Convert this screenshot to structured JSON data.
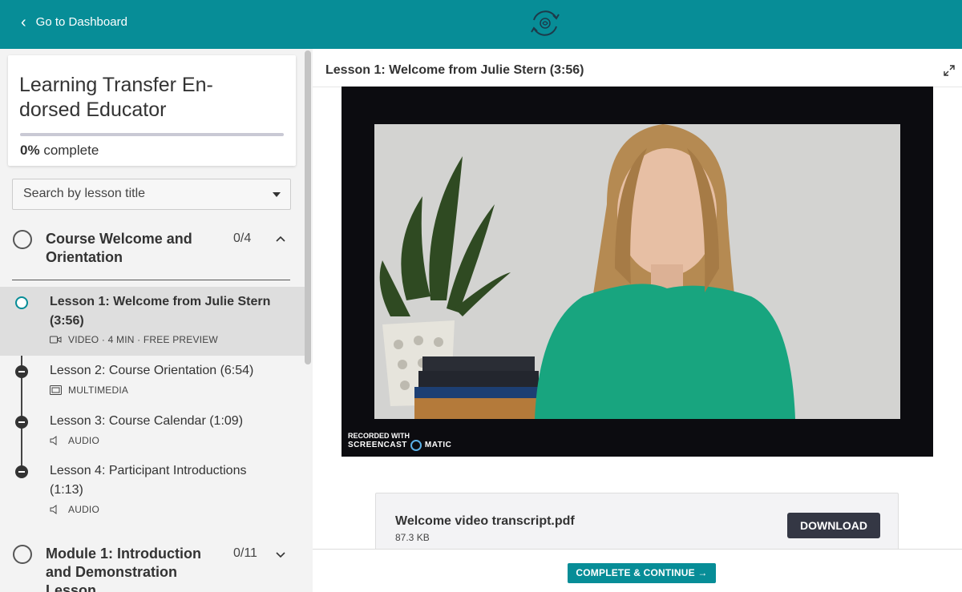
{
  "topbar": {
    "back_label": "Go to Dashboard",
    "accent_color": "#078d97"
  },
  "course": {
    "title": "Learning Transfer En-dorsed Educator",
    "progress_percent": "0%",
    "progress_suffix": "complete",
    "progress_value": 0
  },
  "search": {
    "placeholder": "Search by lesson title"
  },
  "modules": [
    {
      "title": "Course Welcome and Orientation",
      "count": "0/4",
      "expanded": true,
      "lessons": [
        {
          "title": "Lesson 1: Welcome from Julie Stern (3:56)",
          "meta": "VIDEO · 4 MIN · FREE PREVIEW",
          "icon": "video-camera-icon",
          "active": true
        },
        {
          "title": "Lesson 2: Course Orientation (6:54)",
          "meta": "MULTIMEDIA",
          "icon": "multimedia-icon",
          "active": false
        },
        {
          "title": "Lesson 3: Course Calendar (1:09)",
          "meta": "AUDIO",
          "icon": "speaker-icon",
          "active": false
        },
        {
          "title": "Lesson 4: Participant Introductions (1:13)",
          "meta": "AUDIO",
          "icon": "speaker-icon",
          "active": false
        }
      ]
    },
    {
      "title": "Module 1: Introduction and Demonstration Lesson",
      "count": "0/11",
      "expanded": false
    }
  ],
  "main": {
    "lesson_heading": "Lesson 1: Welcome from Julie Stern (3:56)",
    "video": {
      "watermark_top": "RECORDED WITH",
      "watermark_left": "SCREENCAST",
      "watermark_right": "MATIC"
    },
    "attachment": {
      "name": "Welcome video transcript.pdf",
      "size": "87.3 KB",
      "download_label": "DOWNLOAD"
    },
    "complete_label": "COMPLETE & CONTINUE →"
  }
}
